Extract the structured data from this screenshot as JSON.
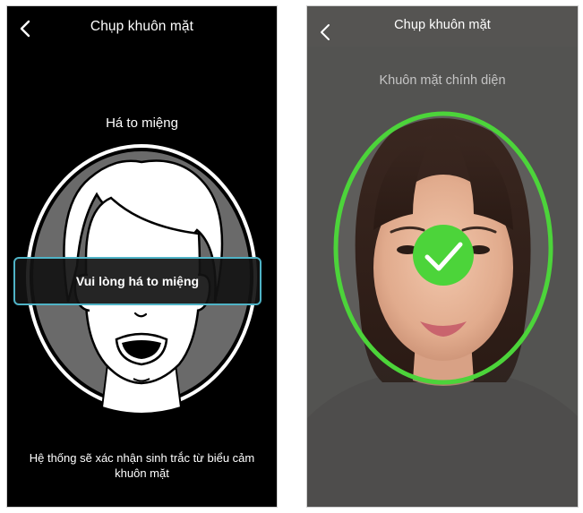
{
  "left_screen": {
    "header": {
      "title": "Chụp khuôn mặt"
    },
    "instruction": "Há to miệng",
    "prompt": "Vui lòng há to miệng",
    "footer": "Hệ thống sẽ xác nhận sinh trắc từ biểu cảm khuôn mặt"
  },
  "right_screen": {
    "header": {
      "title": "Chụp khuôn mặt"
    },
    "instruction": "Khuôn mặt chính diện",
    "status_icon": "check-icon"
  },
  "colors": {
    "left_background": "#000000",
    "right_background": "#5e5d5b",
    "prompt_border": "#4fb3c6",
    "success_green": "#4cd43a"
  }
}
